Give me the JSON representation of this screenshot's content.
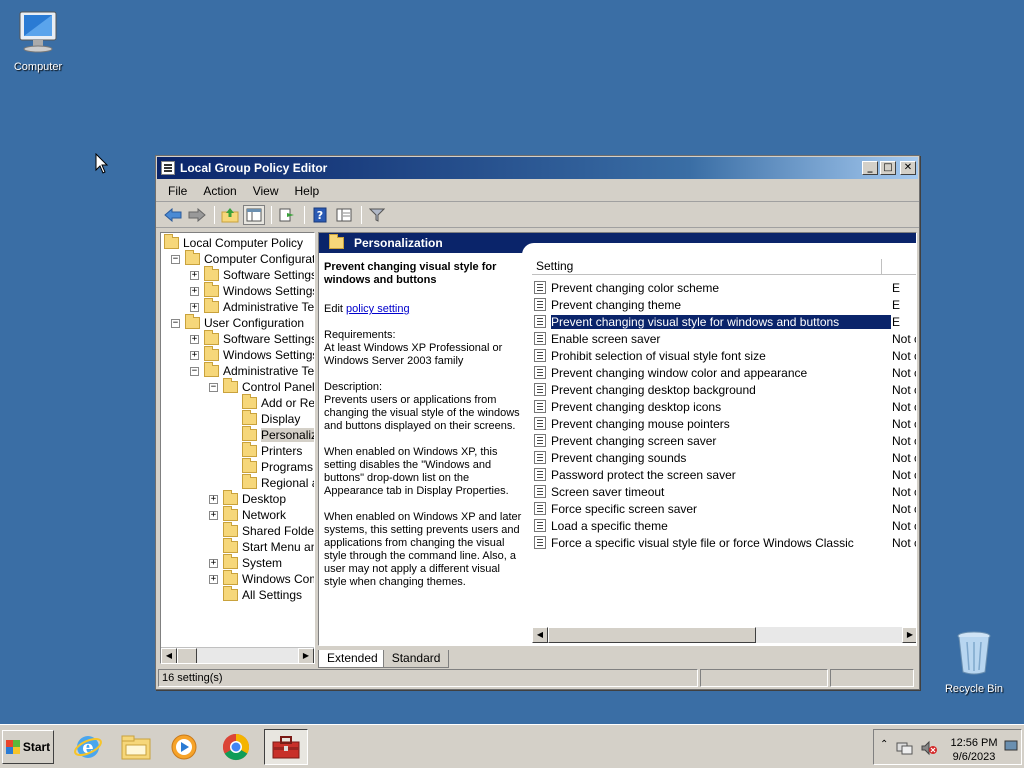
{
  "desktop": {
    "computer_label": "Computer",
    "recycle_label": "Recycle Bin"
  },
  "window": {
    "title": "Local Group Policy Editor",
    "controls": {
      "minimize": "_",
      "maximize": "□",
      "close": "✕"
    },
    "menu": [
      "File",
      "Action",
      "View",
      "Help"
    ],
    "tree": [
      {
        "label": "Local Computer Policy",
        "indent": 0,
        "exp": ""
      },
      {
        "label": "Computer Configuratio",
        "indent": 1,
        "exp": "−"
      },
      {
        "label": "Software Settings",
        "indent": 2,
        "exp": "+"
      },
      {
        "label": "Windows Settings",
        "indent": 2,
        "exp": "+"
      },
      {
        "label": "Administrative Tem",
        "indent": 2,
        "exp": "+"
      },
      {
        "label": "User Configuration",
        "indent": 1,
        "exp": "−"
      },
      {
        "label": "Software Settings",
        "indent": 2,
        "exp": "+"
      },
      {
        "label": "Windows Settings",
        "indent": 2,
        "exp": "+"
      },
      {
        "label": "Administrative Tem",
        "indent": 2,
        "exp": "−"
      },
      {
        "label": "Control Panel",
        "indent": 3,
        "exp": "−"
      },
      {
        "label": "Add or Ren",
        "indent": 4,
        "exp": ""
      },
      {
        "label": "Display",
        "indent": 4,
        "exp": ""
      },
      {
        "label": "Personaliza",
        "indent": 4,
        "exp": "",
        "selected": true
      },
      {
        "label": "Printers",
        "indent": 4,
        "exp": ""
      },
      {
        "label": "Programs",
        "indent": 4,
        "exp": ""
      },
      {
        "label": "Regional ar",
        "indent": 4,
        "exp": ""
      },
      {
        "label": "Desktop",
        "indent": 3,
        "exp": "+"
      },
      {
        "label": "Network",
        "indent": 3,
        "exp": "+"
      },
      {
        "label": "Shared Folders",
        "indent": 3,
        "exp": ""
      },
      {
        "label": "Start Menu and",
        "indent": 3,
        "exp": ""
      },
      {
        "label": "System",
        "indent": 3,
        "exp": "+"
      },
      {
        "label": "Windows Comp",
        "indent": 3,
        "exp": "+"
      },
      {
        "label": "All Settings",
        "indent": 3,
        "exp": ""
      }
    ],
    "header_title": "Personalization",
    "description": {
      "title": "Prevent changing visual style for windows and buttons",
      "edit_prefix": "Edit ",
      "edit_link": "policy setting",
      "requirements": "Requirements:\nAt least Windows XP Professional or Windows Server 2003 family",
      "desc1": "Description:\nPrevents users or applications from changing the visual style of the windows and buttons displayed on their screens.",
      "desc2": "When enabled on Windows XP, this setting disables the \"Windows and buttons\" drop-down list on the Appearance tab in Display Properties.",
      "desc3": "When enabled on Windows XP and later systems, this setting prevents users and applications from changing the visual style through the command line.  Also, a user may not apply a different visual style when changing themes."
    },
    "list_header": "Setting",
    "settings": [
      {
        "name": "Prevent changing color scheme",
        "state": "E"
      },
      {
        "name": "Prevent changing theme",
        "state": "E"
      },
      {
        "name": "Prevent changing visual style for windows and buttons",
        "state": "E",
        "selected": true
      },
      {
        "name": "Enable screen saver",
        "state": "Not c"
      },
      {
        "name": "Prohibit selection of visual style font size",
        "state": "Not c"
      },
      {
        "name": "Prevent changing window color and appearance",
        "state": "Not c"
      },
      {
        "name": "Prevent changing desktop background",
        "state": "Not c"
      },
      {
        "name": "Prevent changing desktop icons",
        "state": "Not c"
      },
      {
        "name": "Prevent changing mouse pointers",
        "state": "Not c"
      },
      {
        "name": "Prevent changing screen saver",
        "state": "Not c"
      },
      {
        "name": "Prevent changing sounds",
        "state": "Not c"
      },
      {
        "name": "Password protect the screen saver",
        "state": "Not c"
      },
      {
        "name": "Screen saver timeout",
        "state": "Not c"
      },
      {
        "name": "Force specific screen saver",
        "state": "Not c"
      },
      {
        "name": "Load a specific theme",
        "state": "Not c"
      },
      {
        "name": "Force a specific visual style file or force Windows Classic",
        "state": "Not c"
      }
    ],
    "tabs": {
      "extended": "Extended",
      "standard": "Standard"
    },
    "status": "16 setting(s)"
  },
  "taskbar": {
    "start_label": "Start",
    "time": "12:56 PM",
    "date": "9/6/2023"
  },
  "colors": {
    "desktop": "#3a6ea5",
    "selection": "#0a246a"
  }
}
